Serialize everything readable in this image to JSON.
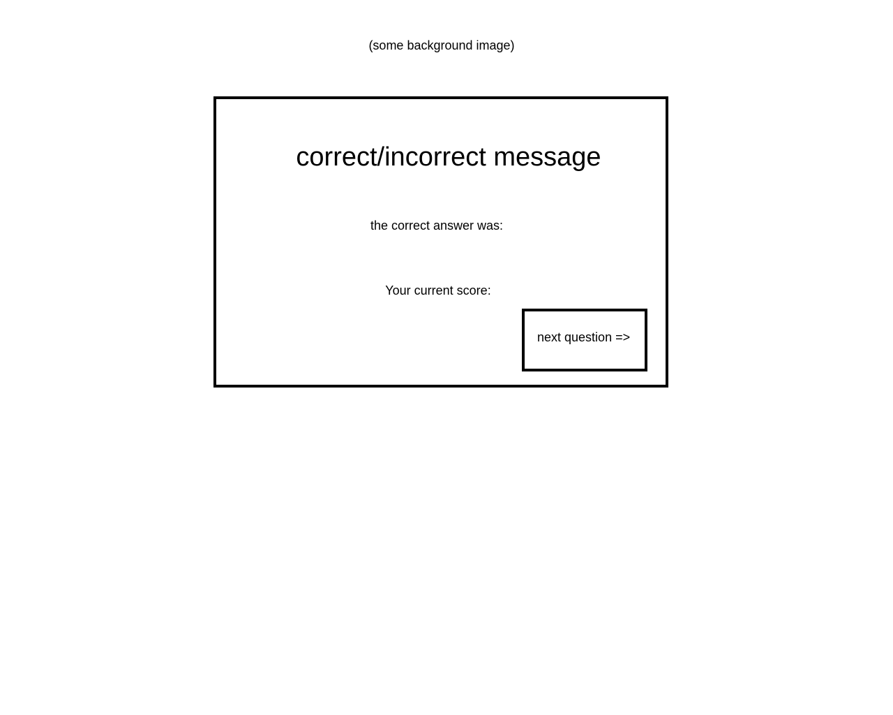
{
  "background": {
    "note": "(some background image)"
  },
  "result_panel": {
    "message": "correct/incorrect message",
    "correct_answer_label": "the correct answer was:",
    "score_label": "Your current score:",
    "next_button_label": "next question =>"
  }
}
